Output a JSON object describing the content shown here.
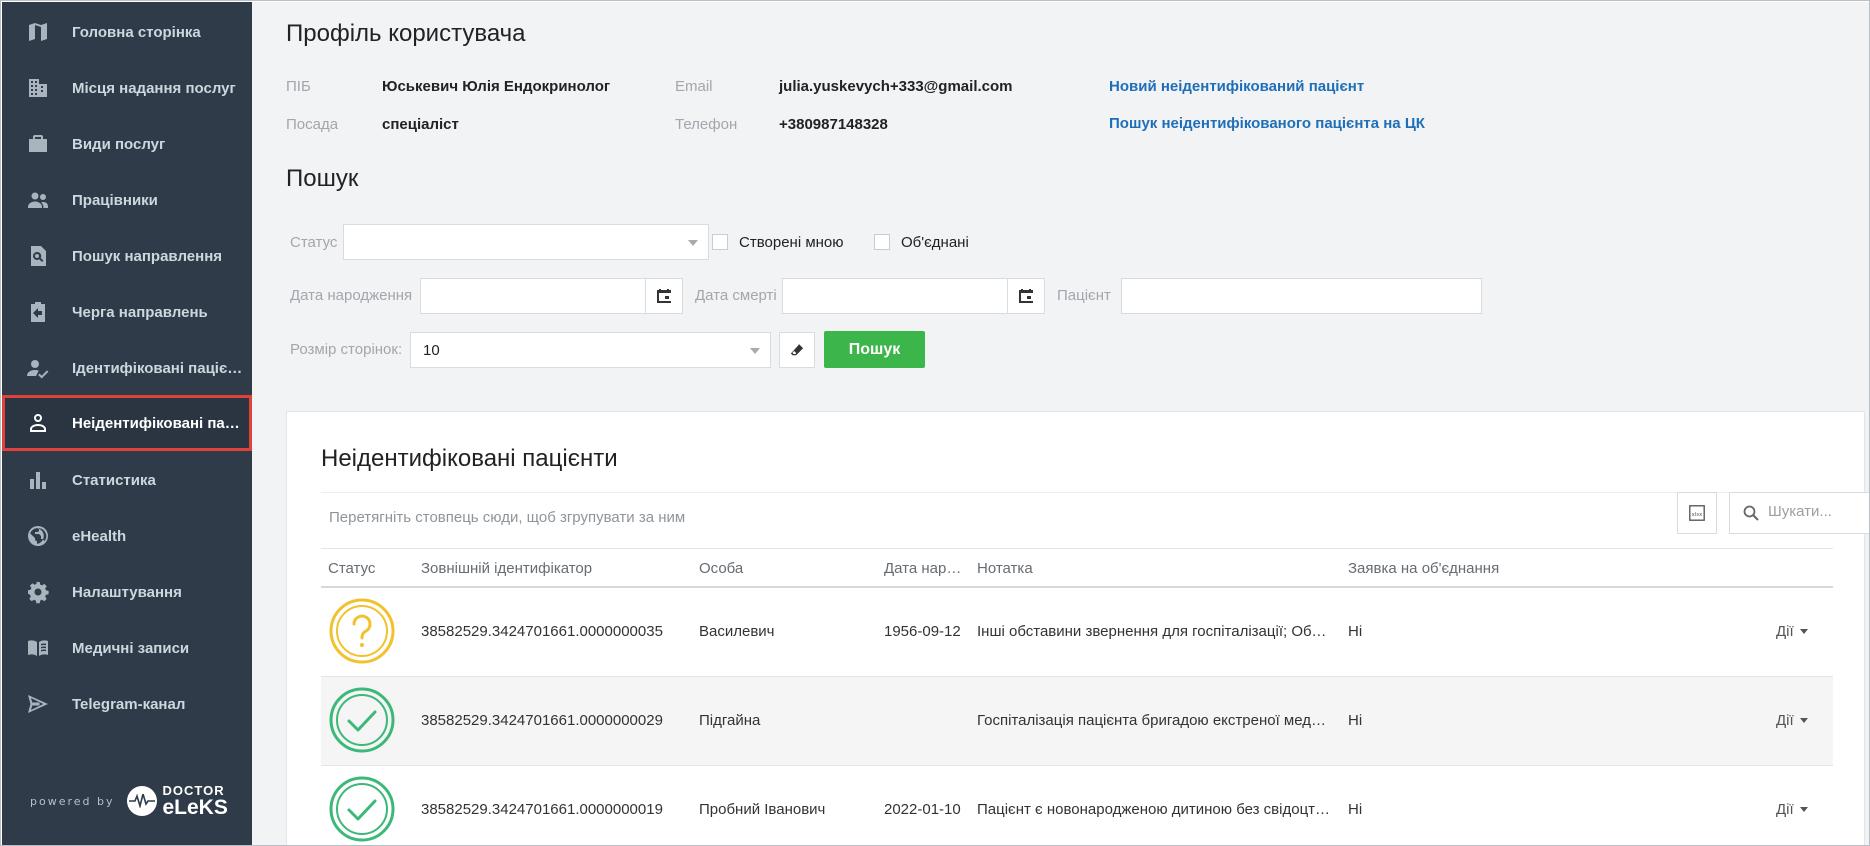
{
  "sidebar": {
    "items": [
      {
        "label": "Головна сторінка",
        "icon": "map-icon"
      },
      {
        "label": "Місця надання послуг",
        "icon": "building-icon"
      },
      {
        "label": "Види послуг",
        "icon": "briefcase-icon"
      },
      {
        "label": "Працівники",
        "icon": "people-icon"
      },
      {
        "label": "Пошук направлення",
        "icon": "search-document-icon"
      },
      {
        "label": "Черга направлень",
        "icon": "clipboard-arrow-icon"
      },
      {
        "label": "Ідентифіковані пацієнти",
        "icon": "person-check-icon"
      },
      {
        "label": "Неідентифіковані пацієнти",
        "icon": "person-outline-icon",
        "active": true
      },
      {
        "label": "Статистика",
        "icon": "bar-chart-icon"
      },
      {
        "label": "eHealth",
        "icon": "globe-icon"
      },
      {
        "label": "Налаштування",
        "icon": "gear-icon"
      },
      {
        "label": "Медичні записи",
        "icon": "book-icon"
      },
      {
        "label": "Telegram-канал",
        "icon": "send-icon"
      }
    ],
    "powered_by": "powered by",
    "brand_line1": "DOCTOR",
    "brand_line2": "eLeKS"
  },
  "profile": {
    "title": "Профіль користувача",
    "pib_label": "ПІБ",
    "pib_value": "Юськевич Юлія Ендокринолог",
    "position_label": "Посада",
    "position_value": "спеціаліст",
    "email_label": "Email",
    "email_value": "julia.yuskevych+333@gmail.com",
    "phone_label": "Телефон",
    "phone_value": "+380987148328",
    "link_new": "Новий неідентифікований пацієнт",
    "link_search": "Пошук неідентифікованого пацієнта на ЦК"
  },
  "search": {
    "title": "Пошук",
    "status_label": "Статус",
    "status_value": "",
    "created_by_me": "Створені мною",
    "merged": "Об'єднані",
    "birth_label": "Дата народження",
    "death_label": "Дата смерті",
    "patient_label": "Пацієнт",
    "page_size_label": "Розмір сторінок:",
    "page_size_value": "10",
    "search_button": "Пошук"
  },
  "panel": {
    "title": "Неідентифіковані пацієнти",
    "group_hint": "Перетягніть стовпець сюди, щоб згрупувати за ним",
    "search_placeholder": "Шукати...",
    "columns": [
      "Статус",
      "Зовнішній ідентифікатор",
      "Особа",
      "Дата народження",
      "Нотатка",
      "Заявка на об'єднання"
    ],
    "rows": [
      {
        "status": "unknown",
        "id": "38582529.3424701661.0000000035",
        "person": "Василевич",
        "birth": "1956-09-12",
        "note": "Інші обставини звернення для госпіталізації; Обставини звернення",
        "merge": "Ні",
        "actions": "Дії"
      },
      {
        "status": "ok",
        "id": "38582529.3424701661.0000000029",
        "person": "Підгайна",
        "birth": "",
        "note": "Госпіталізація пацієнта бригадою екстреної медичної допомоги",
        "merge": "Ні",
        "actions": "Дії"
      },
      {
        "status": "ok",
        "id": "38582529.3424701661.0000000019",
        "person": "Пробний Іванович",
        "birth": "2022-01-10",
        "note": "Пацієнт є новонародженою дитиною без свідоцтва про народження",
        "merge": "Ні",
        "actions": "Дії"
      }
    ]
  },
  "colors": {
    "sidebar_bg": "#2f3b48",
    "accent_green": "#3cb54a",
    "link_blue": "#1f6fb8",
    "status_unknown": "#f2c12e",
    "status_ok": "#3cb878",
    "active_outline": "#e0413b"
  }
}
